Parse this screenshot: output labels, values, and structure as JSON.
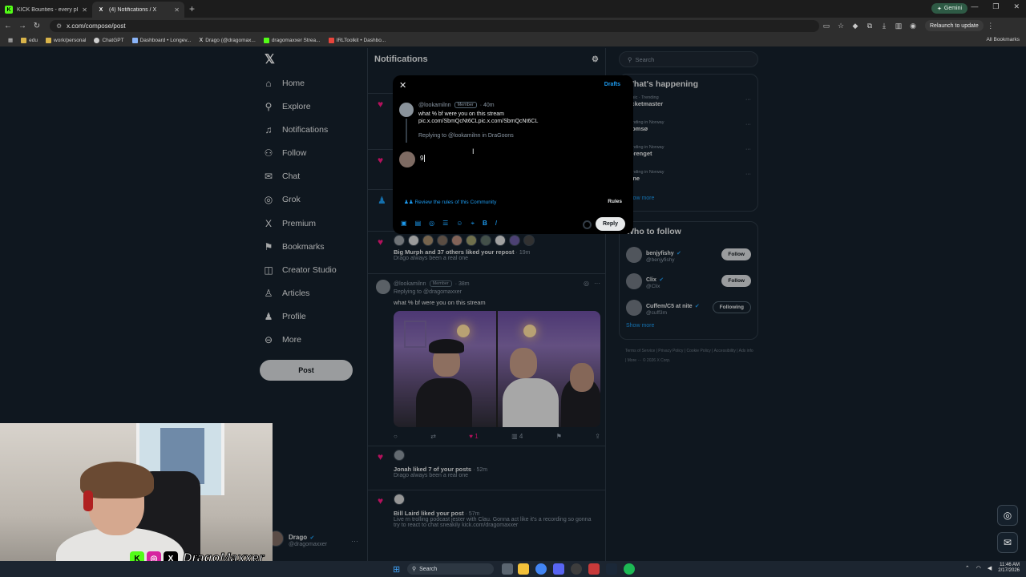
{
  "browser": {
    "tabs": [
      {
        "title": "KICK Bounties - every player fo",
        "favicon": "K",
        "favicon_color": "#53fc18",
        "active": false
      },
      {
        "title": "(4) Notifications / X",
        "favicon": "X",
        "favicon_color": "#ffffff",
        "active": true
      }
    ],
    "gemini_label": "Gemini",
    "url": "x.com/compose/post",
    "relaunch_label": "Relaunch to update",
    "bookmarks": [
      {
        "label": "edu",
        "color": "#d9b44a"
      },
      {
        "label": "work/personal",
        "color": "#d9b44a"
      },
      {
        "label": "ChatGPT",
        "color": "#cfcfcf"
      },
      {
        "label": "Dashboard • Longev...",
        "color": "#8ab4f8"
      },
      {
        "label": "Drago (@dragomax...",
        "color": "#ffffff"
      },
      {
        "label": "dragomaxxer Strea...",
        "color": "#53fc18"
      },
      {
        "label": "IRLToolkit • Dashbo...",
        "color": "#e8453c"
      }
    ],
    "all_bookmarks_label": "All Bookmarks"
  },
  "nav": {
    "items": [
      {
        "label": "Home",
        "icon": "⌂"
      },
      {
        "label": "Explore",
        "icon": "⚲"
      },
      {
        "label": "Notifications",
        "icon": "♫"
      },
      {
        "label": "Follow",
        "icon": "⚇"
      },
      {
        "label": "Chat",
        "icon": "✉"
      },
      {
        "label": "Grok",
        "icon": "◎"
      },
      {
        "label": "Premium",
        "icon": "X"
      },
      {
        "label": "Bookmarks",
        "icon": "⚑"
      },
      {
        "label": "Creator Studio",
        "icon": "◫"
      },
      {
        "label": "Articles",
        "icon": "♙"
      },
      {
        "label": "Profile",
        "icon": "♟"
      },
      {
        "label": "More",
        "icon": "⊖"
      }
    ],
    "post_label": "Post",
    "profile_name": "Drago",
    "profile_handle": "@dragomaxxer"
  },
  "feed": {
    "title": "Notifications",
    "n1_text": "Big Murph and 37 others liked your repost",
    "n1_time": "· 19m",
    "n1_sub": "Drago always been a real one",
    "post_handle": "@lookamilnn",
    "post_badge": "Member",
    "post_time": "· 38m",
    "post_replying": "Replying to @dragomaxxer",
    "post_text": "what % bf were you on this stream",
    "post_likes": "1",
    "post_views": "4",
    "n2_text": "Jonah liked 7 of your posts",
    "n2_time": "· 52m",
    "n2_sub": "Drago always been a real one",
    "n3_text": "Bill Laird liked your post",
    "n3_time": "· 57m",
    "n3_sub": "Live rn trolling podcast jester with Clau. Gonna act like it's a recording so gonna try to react to chat sneakily kick.com/dragomaxxer"
  },
  "compose": {
    "drafts_label": "Drafts",
    "orig_handle": "@lookamilnn",
    "orig_badge": "Member",
    "orig_time": "· 40m",
    "orig_text": "what % bf were you on this stream pic.x.com/SbmQcNt6CLpic.x.com/SbmQcNt6CL",
    "orig_replying": "Replying to @lookamilnn in DraGoons",
    "reply_value": "9",
    "rules_hint": "Review the rules of this Community",
    "rules_label": "Rules",
    "reply_button": "Reply"
  },
  "right": {
    "search_placeholder": "Search",
    "happening_title": "What's happening",
    "trends": [
      {
        "context": "Music · Trending",
        "name": "Ticketmaster"
      },
      {
        "context": "Trending in Norway",
        "name": "Tromsø"
      },
      {
        "context": "Trending in Norway",
        "name": "Sprenget"
      },
      {
        "context": "Trending in Norway",
        "name": "Jane"
      }
    ],
    "show_more": "Show more",
    "wtf_title": "Who to follow",
    "who_to_follow": [
      {
        "name": "benjyfishy",
        "handle": "@benjyfishy",
        "button": "Follow"
      },
      {
        "name": "Clix",
        "handle": "@Clix",
        "button": "Follow"
      },
      {
        "name": "Cuffem/C5 at nite",
        "handle": "@cuff3m",
        "button": "Following"
      }
    ],
    "show_more_2": "Show more",
    "footer": "Terms of Service  |  Privacy Policy  |  Cookie Policy  |  Accessibility  |  Ads info  |  More ···  © 2026 X Corp."
  },
  "webcam": {
    "handle": "DragoMaxxer"
  },
  "taskbar": {
    "search_label": "Search",
    "time": "11:46 AM",
    "date": "2/17/2026"
  },
  "colors": {
    "bg": "#15202b",
    "accent": "#1d9bf0",
    "like": "#f91880"
  }
}
